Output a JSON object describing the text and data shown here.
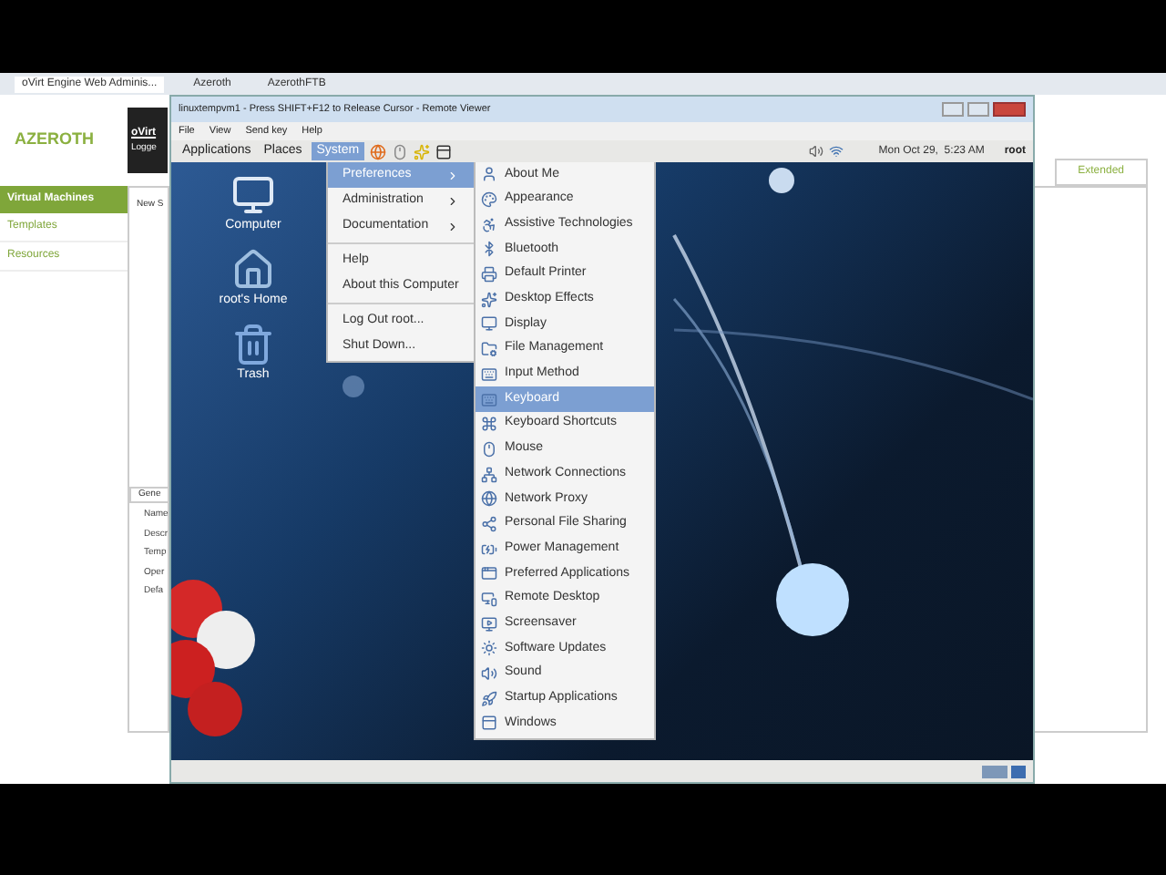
{
  "browser_tabs": [
    {
      "label": "oVirt Engine Web Adminis...",
      "selected": true
    },
    {
      "label": "Azeroth",
      "selected": false
    },
    {
      "label": "AzerothFTB",
      "selected": false
    }
  ],
  "background_app": {
    "logo": "AZEROTH",
    "header": [
      "oVirt",
      "Logge"
    ],
    "sidebar": [
      {
        "label": "Virtual Machines",
        "selected": true
      },
      {
        "label": "Templates",
        "selected": false
      },
      {
        "label": "Resources",
        "selected": false
      }
    ],
    "toolbar_text": "New S",
    "right_tab": "Extended",
    "detail_tab": "Gene",
    "fields": [
      "Name",
      "Descr",
      "Temp",
      "Oper",
      "Defa"
    ]
  },
  "viewer": {
    "title": "linuxtempvm1 - Press SHIFT+F12 to Release Cursor - Remote Viewer",
    "menu": [
      "File",
      "View",
      "Send key",
      "Help"
    ],
    "panel": {
      "menus": [
        {
          "label": "Applications",
          "selected": false
        },
        {
          "label": "Places",
          "selected": false
        },
        {
          "label": "System",
          "selected": true
        }
      ],
      "clock": "Mon Oct 29,  5:23 AM",
      "user": "root"
    },
    "desktop_icons": [
      {
        "label": "Computer",
        "kind": "computer"
      },
      {
        "label": "root's Home",
        "kind": "folder"
      },
      {
        "label": "Trash",
        "kind": "trash"
      }
    ],
    "system_menu": [
      [
        {
          "label": "Preferences",
          "selected": true,
          "submenu": true
        },
        {
          "label": "Administration",
          "selected": false,
          "submenu": true
        },
        {
          "label": "Documentation",
          "selected": false,
          "submenu": true
        }
      ],
      [
        {
          "label": "Help",
          "selected": false,
          "submenu": false
        },
        {
          "label": "About this Computer",
          "selected": false,
          "submenu": false
        }
      ],
      [
        {
          "label": "Log Out root...",
          "selected": false,
          "submenu": false
        },
        {
          "label": "Shut Down...",
          "selected": false,
          "submenu": false
        }
      ]
    ],
    "preferences_menu": [
      {
        "label": "About Me",
        "selected": false
      },
      {
        "label": "Appearance",
        "selected": false
      },
      {
        "label": "Assistive Technologies",
        "selected": false
      },
      {
        "label": "Bluetooth",
        "selected": false
      },
      {
        "label": "Default Printer",
        "selected": false
      },
      {
        "label": "Desktop Effects",
        "selected": false
      },
      {
        "label": "Display",
        "selected": false
      },
      {
        "label": "File Management",
        "selected": false
      },
      {
        "label": "Input Method",
        "selected": false
      },
      {
        "label": "Keyboard",
        "selected": true
      },
      {
        "label": "Keyboard Shortcuts",
        "selected": false
      },
      {
        "label": "Mouse",
        "selected": false
      },
      {
        "label": "Network Connections",
        "selected": false
      },
      {
        "label": "Network Proxy",
        "selected": false
      },
      {
        "label": "Personal File Sharing",
        "selected": false
      },
      {
        "label": "Power Management",
        "selected": false
      },
      {
        "label": "Preferred Applications",
        "selected": false
      },
      {
        "label": "Remote Desktop",
        "selected": false
      },
      {
        "label": "Screensaver",
        "selected": false
      },
      {
        "label": "Software Updates",
        "selected": false
      },
      {
        "label": "Sound",
        "selected": false
      },
      {
        "label": "Startup Applications",
        "selected": false
      },
      {
        "label": "Windows",
        "selected": false
      }
    ]
  }
}
